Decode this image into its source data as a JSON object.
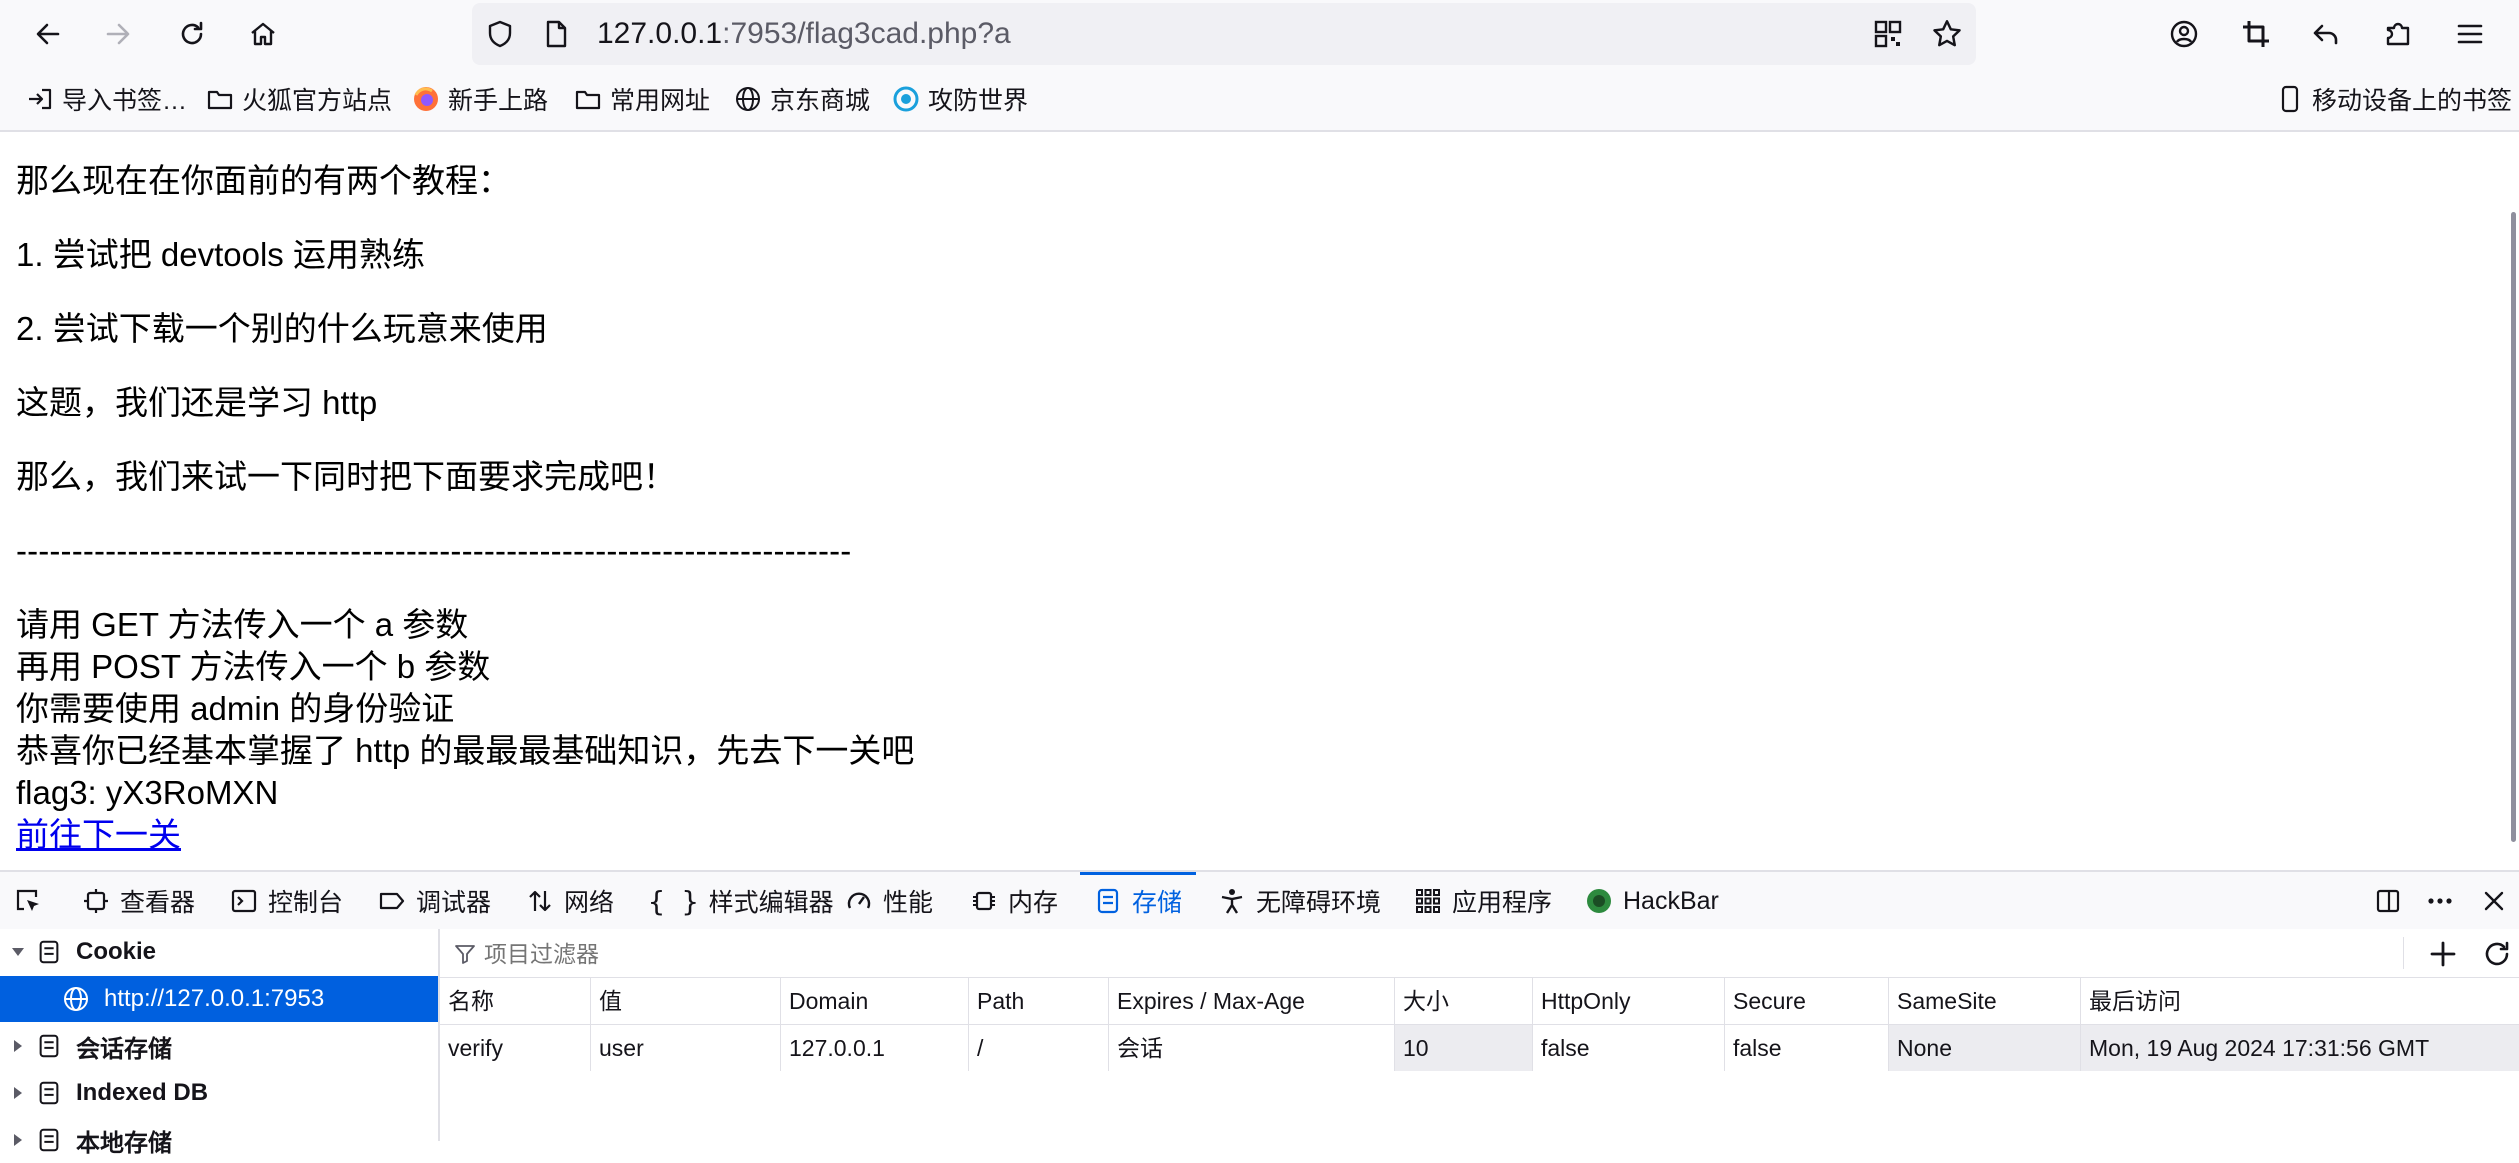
{
  "url": {
    "host": "127.0.0.1",
    "rest": ":7953/flag3cad.php?a"
  },
  "bookmarks": {
    "items": [
      "导入书签…",
      "火狐官方站点",
      "新手上路",
      "常用网址",
      "京东商城",
      "攻防世界"
    ],
    "mobile": "移动设备上的书签"
  },
  "page": {
    "lines": [
      "那么现在在你面前的有两个教程：",
      "1. 尝试把 devtools 运用熟练",
      "2. 尝试下载一个别的什么玩意来使用",
      "这题，我们还是学习 http",
      "那么，我们来试一下同时把下面要求完成吧！",
      "---------------------------------------------------------------------------",
      "请用 GET 方法传入一个 a 参数",
      "再用 POST 方法传入一个 b 参数",
      "你需要使用 admin 的身份验证",
      "恭喜你已经基本掌握了 http 的最最最基础知识，先去下一关吧",
      "flag3: yX3RoMXN"
    ],
    "link": "前往下一关",
    "link_color": "#0000ee"
  },
  "devtools": {
    "tabs": [
      "查看器",
      "控制台",
      "调试器",
      "网络",
      "样式编辑器",
      "性能",
      "内存",
      "存储",
      "无障碍环境",
      "应用程序",
      "HackBar"
    ],
    "active_tab": "存储",
    "sidebar": {
      "cookie": "Cookie",
      "cookie_host": "http://127.0.0.1:7953",
      "session": "会话存储",
      "indexeddb": "Indexed DB",
      "local": "本地存储"
    },
    "filter_placeholder": "项目过滤器",
    "columns": [
      "名称",
      "值",
      "Domain",
      "Path",
      "Expires / Max-Age",
      "大小",
      "HttpOnly",
      "Secure",
      "SameSite",
      "最后访问"
    ],
    "row": [
      "verify",
      "user",
      "127.0.0.1",
      "/",
      "会话",
      "10",
      "false",
      "false",
      "None",
      "Mon, 19 Aug 2024 17:31:56 GMT"
    ],
    "accent": "#0061e0"
  }
}
